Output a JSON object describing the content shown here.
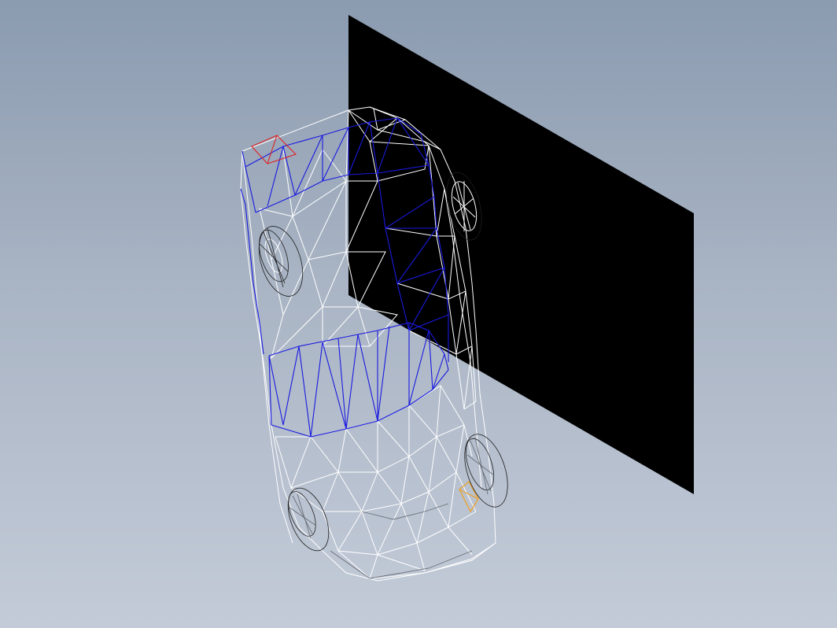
{
  "viewport": {
    "background_top": "#8b9bb0",
    "background_bottom": "#c3cbd8"
  },
  "scene": {
    "objects": [
      "background-plane",
      "car-wireframe",
      "front-left-wheel",
      "front-right-wheel",
      "rear-left-wheel",
      "rear-right-wheel"
    ],
    "colors": {
      "plane": "#000000",
      "mesh": "#ffffff",
      "selected_edges": "#1a1adf",
      "highlight_red": "#e02020",
      "highlight_orange": "#f0a020",
      "wheel": "#1e1e1e"
    }
  }
}
